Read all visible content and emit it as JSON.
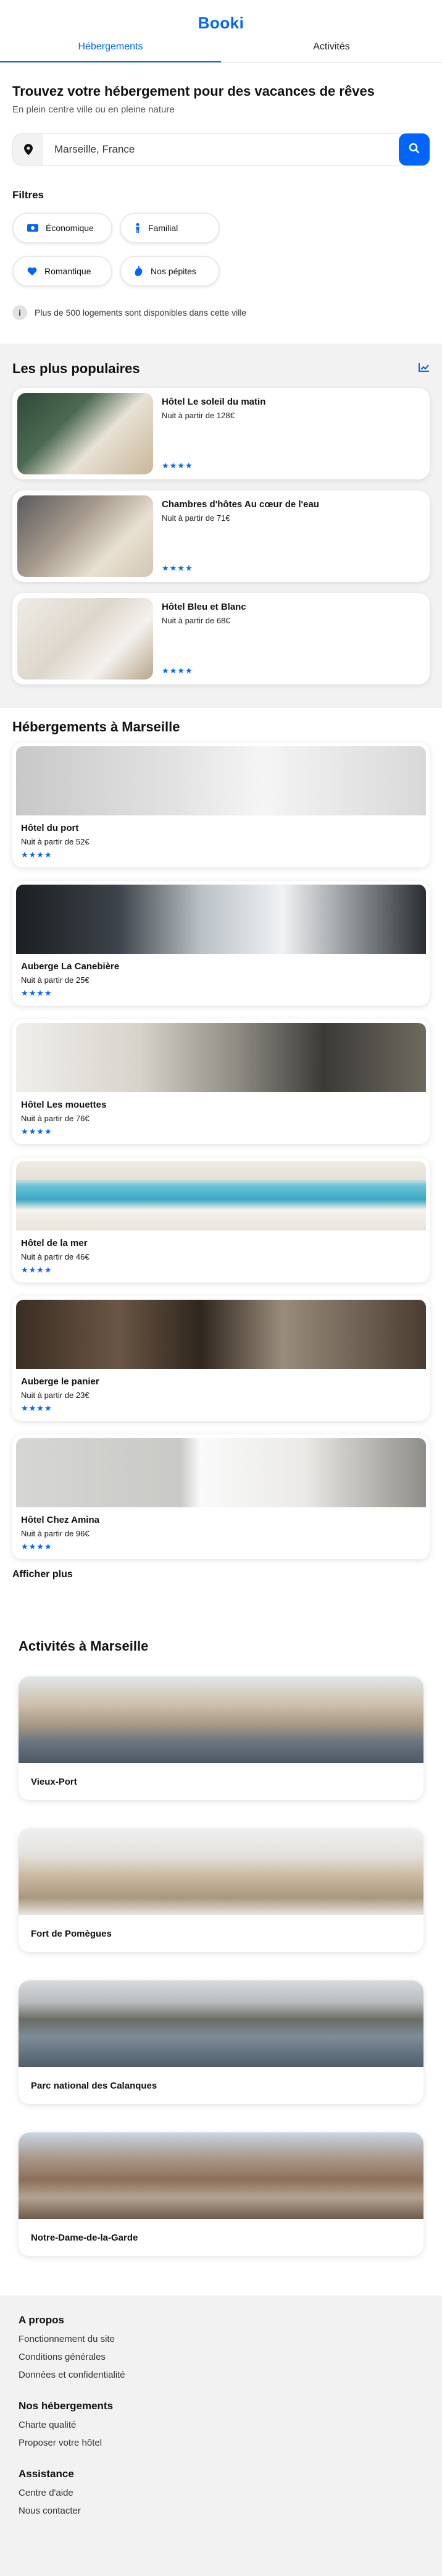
{
  "header": {
    "logo": "Booki",
    "tabs": [
      "Hébergements",
      "Activités"
    ]
  },
  "hero": {
    "title": "Trouvez votre hébergement pour des vacances de rêves",
    "subtitle": "En plein centre ville ou en pleine nature"
  },
  "search": {
    "value": "Marseille, France"
  },
  "filters": {
    "title": "Filtres",
    "items": [
      {
        "label": "Économique",
        "icon": "money-icon"
      },
      {
        "label": "Familial",
        "icon": "child-icon"
      },
      {
        "label": "Romantique",
        "icon": "heart-icon"
      },
      {
        "label": "Nos pépites",
        "icon": "pepper-icon"
      }
    ]
  },
  "info": {
    "icon": "i",
    "text": "Plus de 500 logements sont disponibles dans cette ville"
  },
  "popular": {
    "title": "Les plus populaires",
    "items": [
      {
        "name": "Hôtel Le soleil du matin",
        "price": "Nuit à partir de 128€",
        "stars": "★★★★"
      },
      {
        "name": "Chambres d'hôtes Au cœur de l'eau",
        "price": "Nuit à partir de 71€",
        "stars": "★★★★"
      },
      {
        "name": "Hôtel Bleu et Blanc",
        "price": "Nuit à partir de 68€",
        "stars": "★★★★"
      }
    ]
  },
  "hebergements": {
    "title": "Hébergements à Marseille",
    "items": [
      {
        "name": "Hôtel du port",
        "price": "Nuit à partir de 52€",
        "stars": "★★★★"
      },
      {
        "name": "Auberge La Canebière",
        "price": "Nuit à partir de 25€",
        "stars": "★★★★"
      },
      {
        "name": "Hôtel Les mouettes",
        "price": "Nuit à partir de 76€",
        "stars": "★★★★"
      },
      {
        "name": "Hôtel de la mer",
        "price": "Nuit à partir de 46€",
        "stars": "★★★★"
      },
      {
        "name": "Auberge le panier",
        "price": "Nuit à partir de 23€",
        "stars": "★★★★"
      },
      {
        "name": "Hôtel Chez Amina",
        "price": "Nuit à partir de 96€",
        "stars": "★★★★"
      }
    ],
    "more": "Afficher plus"
  },
  "activites": {
    "title": "Activités à Marseille",
    "items": [
      {
        "name": "Vieux-Port"
      },
      {
        "name": "Fort de Pomègues"
      },
      {
        "name": "Parc national des Calanques"
      },
      {
        "name": "Notre-Dame-de-la-Garde"
      }
    ]
  },
  "footer": {
    "groups": [
      {
        "title": "A propos",
        "links": [
          "Fonctionnement du site",
          "Conditions générales",
          "Données et confidentialité"
        ]
      },
      {
        "title": "Nos hébergements",
        "links": [
          "Charte qualité",
          "Proposer votre hôtel"
        ]
      },
      {
        "title": "Assistance",
        "links": [
          "Centre d'aide",
          "Nous contacter"
        ]
      }
    ]
  },
  "colors": {
    "accent": "#0065fc",
    "background_alt": "#f2f2f2"
  }
}
